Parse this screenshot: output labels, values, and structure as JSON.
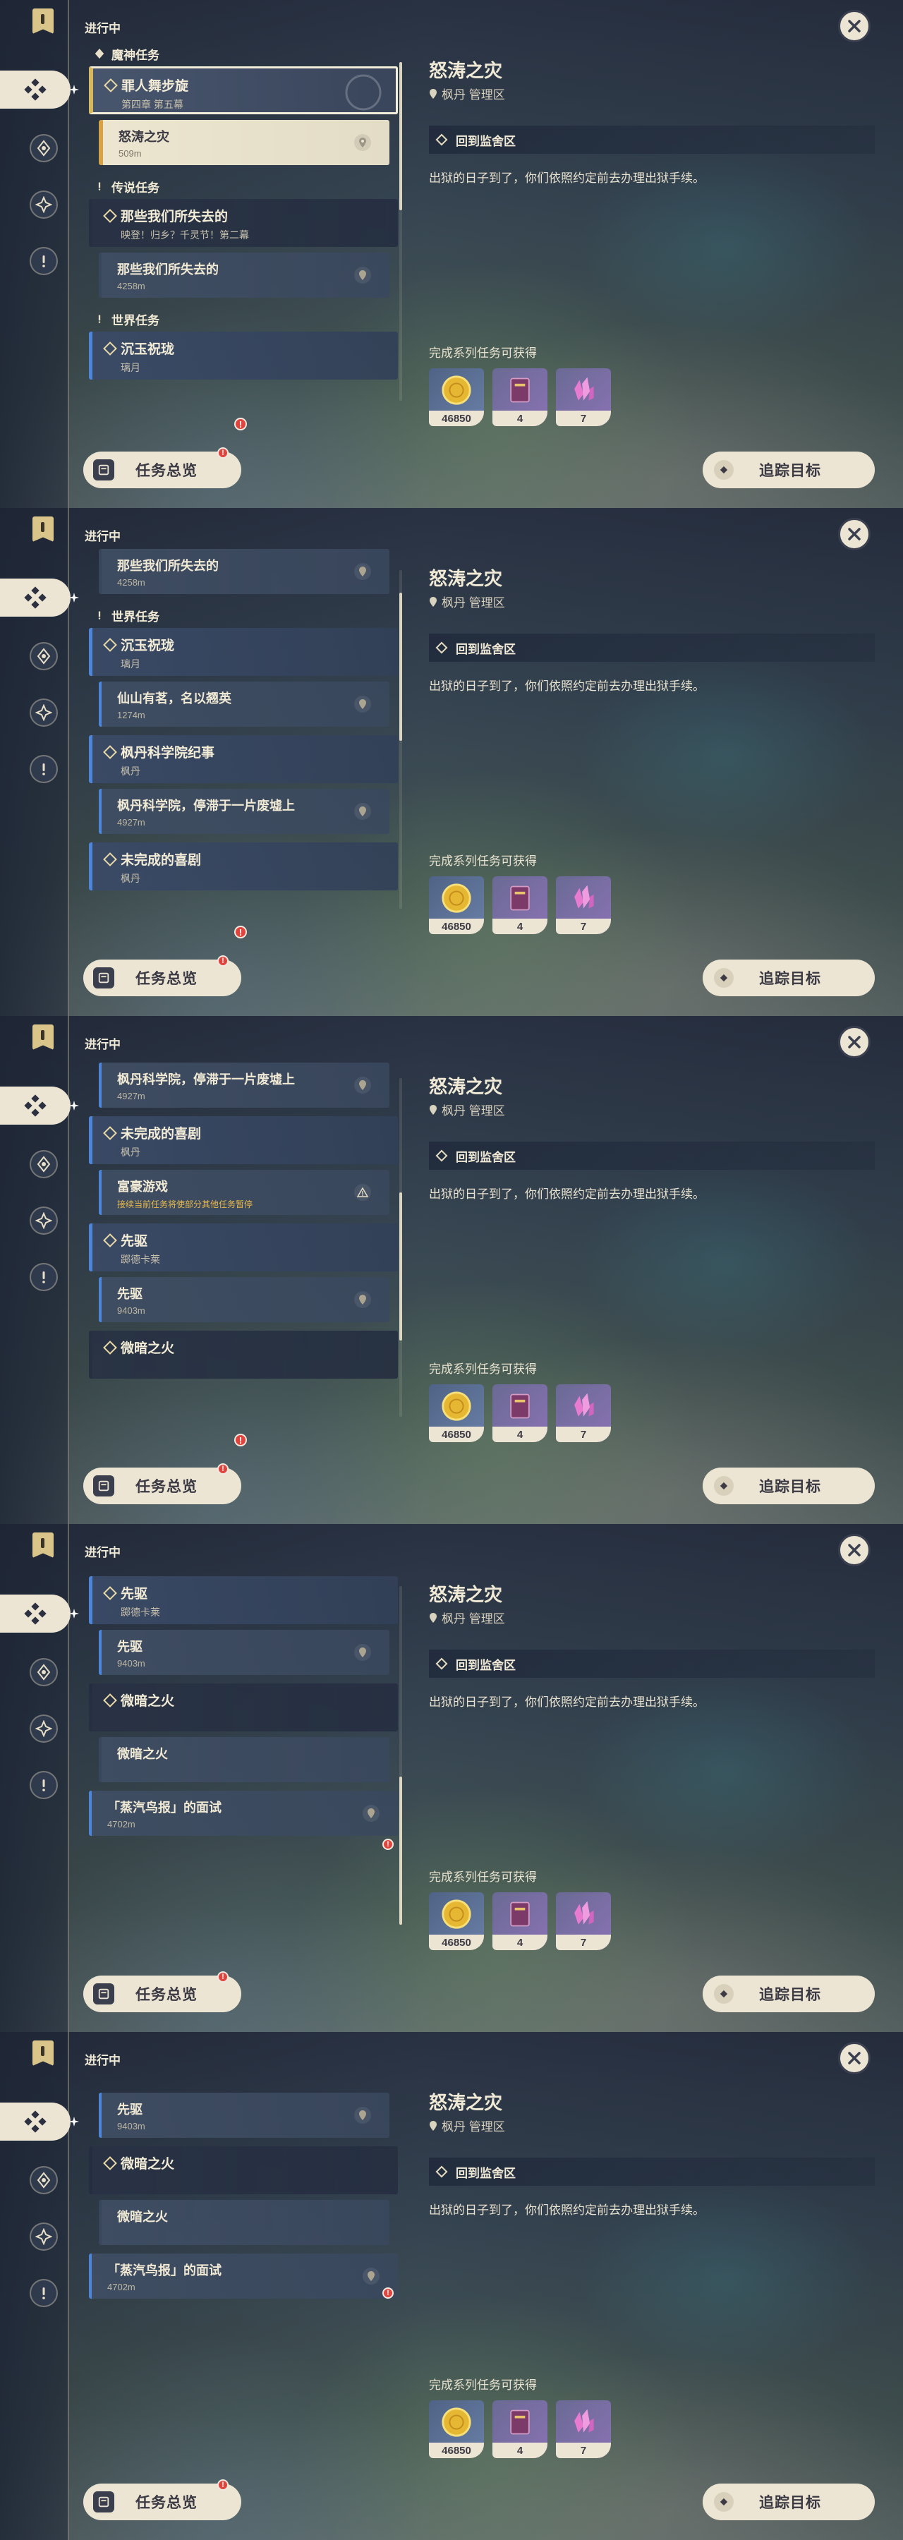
{
  "header": {
    "in_progress_label": "进行中"
  },
  "detail": {
    "title": "怒涛之灾",
    "location": "枫丹 管理区",
    "current_step": "回到监舍区",
    "description": "出狱的日子到了，你们依照约定前去办理出狱手续。",
    "reward_title": "完成系列任务可获得",
    "rewards": [
      {
        "icon": "mora-coin-icon",
        "count": "46850"
      },
      {
        "icon": "heros-wit-book-icon",
        "count": "4"
      },
      {
        "icon": "primogem-crystal-icon",
        "count": "7"
      }
    ]
  },
  "buttons": {
    "overview": "任务总览",
    "track": "追踪目标",
    "overview_badge": "!"
  },
  "quests": {
    "archon_section": "魔神任务",
    "legend_section": "传说任务",
    "world_section": "世界任务",
    "q_archon": {
      "name": "罪人舞步旋",
      "sub": "第四章 第五幕"
    },
    "q_archon_sub": {
      "name": "怒涛之灾",
      "dist": "509m"
    },
    "q_legend": {
      "name": "那些我们所失去的",
      "sub": "映登！归乡？千灵节！第二幕"
    },
    "q_legend_sub": {
      "name": "那些我们所失去的",
      "dist": "4258m"
    },
    "q_world1": {
      "name": "沉玉祝珑",
      "sub": "璃月"
    },
    "q_world1_sub": {
      "name": "仙山有茗，名以翘英",
      "dist": "1274m"
    },
    "q_world2": {
      "name": "枫丹科学院纪事",
      "sub": "枫丹"
    },
    "q_world2_sub": {
      "name": "枫丹科学院，停滞于一片废墟上",
      "dist": "4927m"
    },
    "q_world3": {
      "name": "未完成的喜剧",
      "sub": "枫丹"
    },
    "q_world3_sub": {
      "name": "富豪游戏",
      "warn": "接续当前任务将使部分其他任务暂停"
    },
    "q_world4": {
      "name": "先驱",
      "sub": "踯德卡莱"
    },
    "q_world4_sub": {
      "name": "先驱",
      "dist": "9403m"
    },
    "q_world5": {
      "name": "微暗之火"
    },
    "q_world5_sub": {
      "name": "微暗之火"
    },
    "q_world6": {
      "name": "「蒸汽鸟报」的面试",
      "dist": "4702m"
    }
  }
}
